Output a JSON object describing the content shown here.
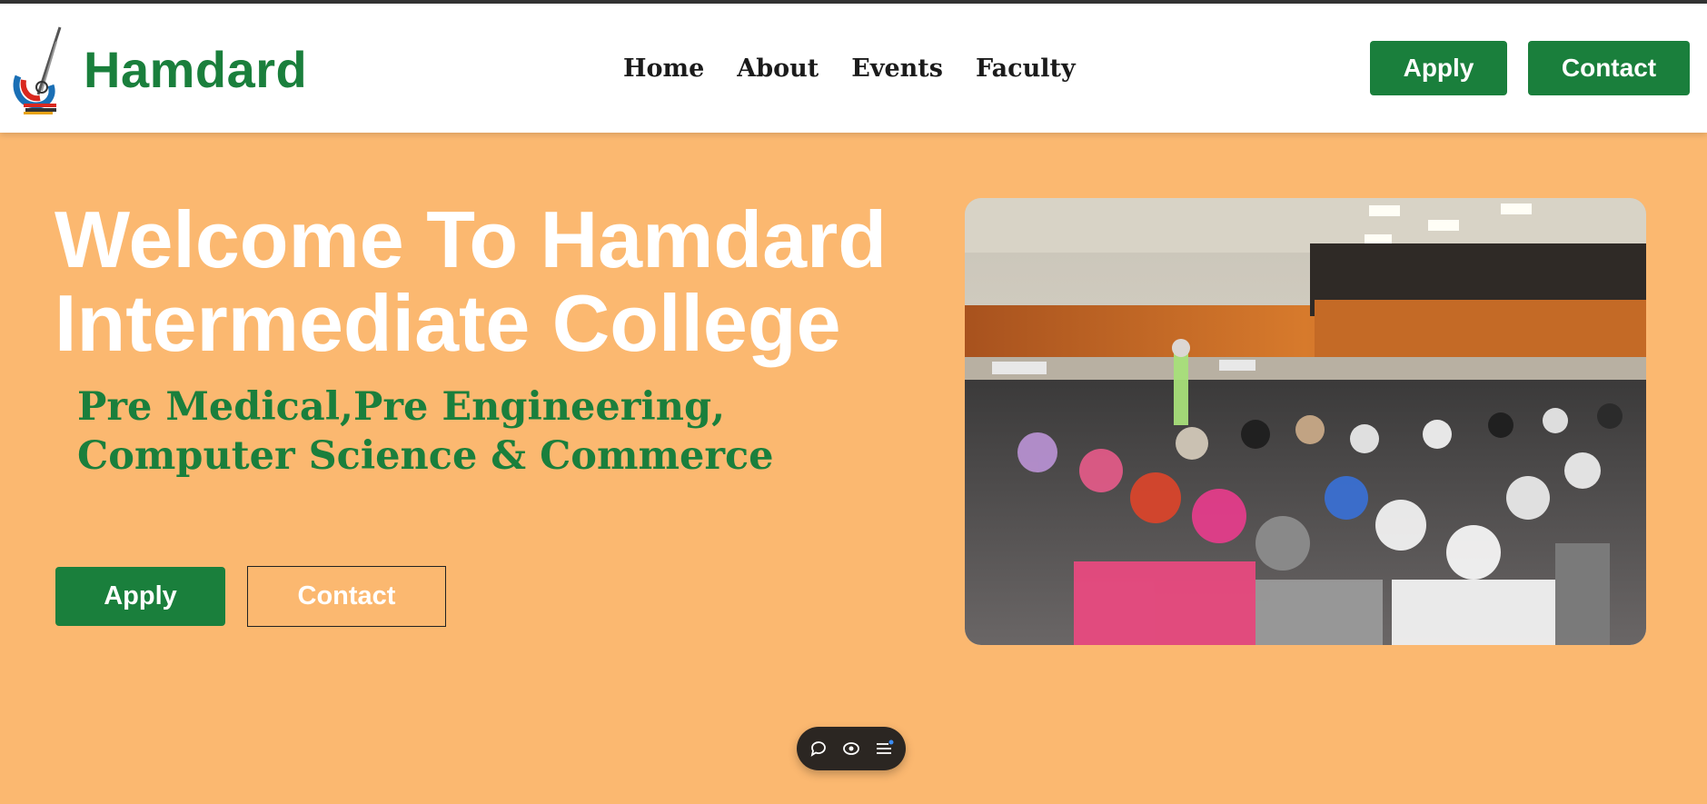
{
  "header": {
    "brand": "Hamdard",
    "nav": [
      "Home",
      "About",
      "Events",
      "Faculty"
    ],
    "apply_label": "Apply",
    "contact_label": "Contact"
  },
  "hero": {
    "title_line1": "Welcome To Hamdard",
    "title_line2": "Intermediate College",
    "subtitle_line1": "Pre Medical,Pre Engineering,",
    "subtitle_line2": "Computer Science & Commerce",
    "apply_label": "Apply",
    "contact_label": "Contact"
  },
  "toolbar": {
    "icons": [
      "comment-icon",
      "eye-icon",
      "menu-icon"
    ]
  },
  "colors": {
    "background": "#fbb870",
    "brand_green": "#1a7f3c",
    "header_bg": "#ffffff",
    "toolbar_bg": "#2b2622"
  }
}
